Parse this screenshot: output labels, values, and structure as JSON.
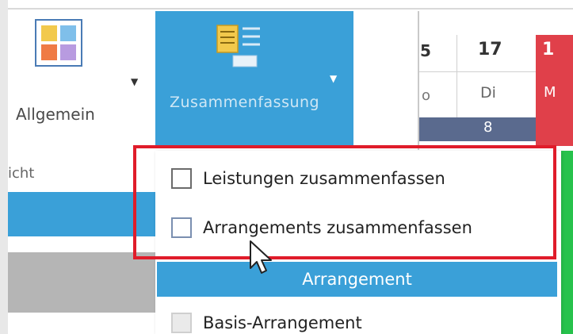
{
  "ribbon": {
    "allgemein_label": "Allgemein",
    "zusammenfassung_label": "Zusammenfassung",
    "group_label": "icht"
  },
  "calendar": {
    "left_day_number": "5",
    "left_day_name": "o",
    "day_number": "17",
    "day_name": "Di",
    "red_day_number": "1",
    "red_day_name": "M",
    "week_count": "8"
  },
  "dropdown": {
    "items": [
      {
        "label": "Leistungen zusammenfassen",
        "checked": false
      },
      {
        "label": "Arrangements zusammenfassen",
        "checked": false
      }
    ],
    "section_header": "Arrangement",
    "section_items": [
      {
        "label": "Basis-Arrangement",
        "checked": false
      }
    ]
  },
  "colors": {
    "accent_blue": "#3aa0d8",
    "highlight_red": "#e01c2a",
    "weekend_red": "#e0404a",
    "week_row": "#5a6a8e",
    "green": "#27c24c"
  }
}
